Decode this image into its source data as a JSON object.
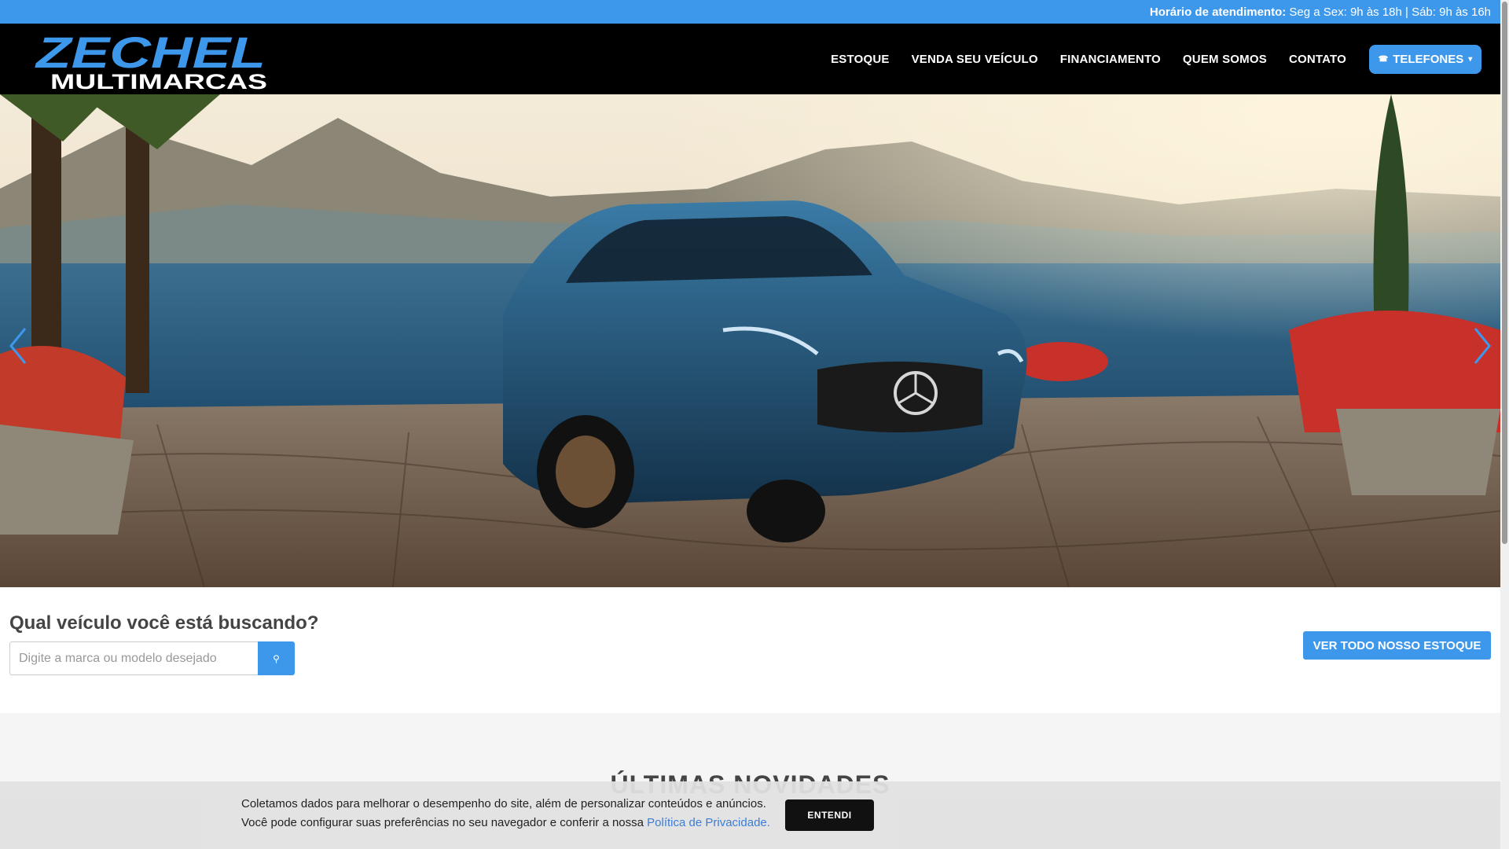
{
  "topbar": {
    "hours_label": "Horário de atendimento:",
    "hours_text": " Seg a Sex: 9h às 18h | Sáb: 9h às 16h"
  },
  "brand": {
    "logo_line1": "ZECHEL",
    "logo_line2": "MULTIMARCAS"
  },
  "nav": {
    "items": [
      {
        "label": "ESTOQUE"
      },
      {
        "label": "VENDA SEU VEÍCULO"
      },
      {
        "label": "FINANCIAMENTO"
      },
      {
        "label": "QUEM SOMOS"
      },
      {
        "label": "CONTATO"
      }
    ],
    "phones_label": "TELEFONES",
    "phones_icon": "phone-icon",
    "phones_caret": "chevron-down-icon"
  },
  "hero": {
    "prev_icon": "chevron-left-icon",
    "next_icon": "chevron-right-icon"
  },
  "search": {
    "title": "Qual veículo você está buscando?",
    "placeholder": "Digite a marca ou modelo desejado",
    "button_icon": "search-icon",
    "stock_button": "VER TODO NOSSO ESTOQUE"
  },
  "news": {
    "title": "ÚLTIMAS NOVIDADES"
  },
  "cookie": {
    "line1": "Coletamos dados para melhorar o desempenho do site, além de personalizar conteúdos e anúncios.",
    "line2": "Você pode configurar suas preferências no seu navegador e conferir a nossa ",
    "link": "Política de Privacidade.",
    "accept": "ENTENDI"
  },
  "colors": {
    "accent": "#3d98ec",
    "header_bg": "#000000"
  }
}
